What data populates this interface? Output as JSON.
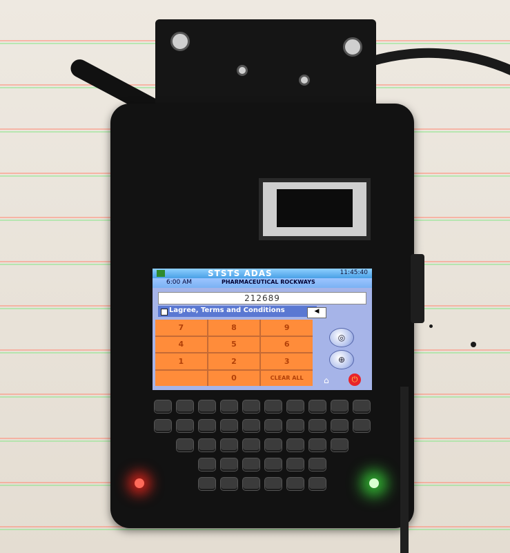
{
  "screen": {
    "title": "STSTS ADAS",
    "time": "11:45:40",
    "status_left": "6:00 AM",
    "subheader": "PHARMACEUTICAL ROCKWAYS",
    "input_value": "212689",
    "checkbox_label": "Lagree, Terms and Conditions",
    "speaker_label": "◀",
    "keypad": [
      "7",
      "8",
      "9",
      "4",
      "5",
      "6",
      "1",
      "2",
      "3",
      "",
      "0",
      "CLEAR ALL"
    ],
    "side_buttons": [
      "◎",
      "⊕"
    ],
    "home_icon": "⌂",
    "power_icon": "⏻"
  },
  "icons": {
    "keyboard": "keyboard-icon",
    "led_red": "red-status-led",
    "led_green": "green-status-led"
  },
  "colors": {
    "keypad_bg": "#ff8c3a",
    "screen_bg": "#a6b4e8",
    "device": "#121212"
  }
}
